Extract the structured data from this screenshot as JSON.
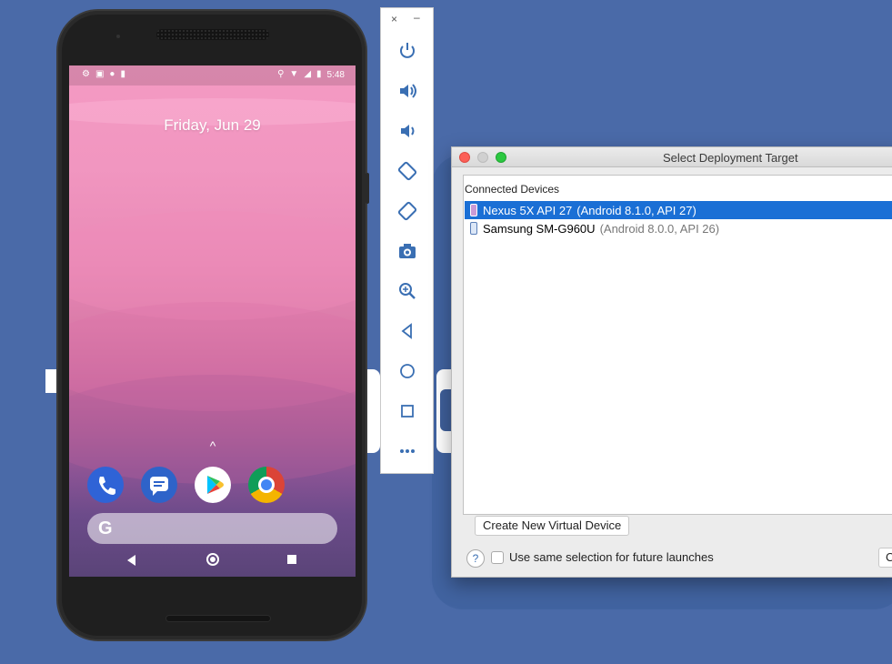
{
  "phone": {
    "status_time": "5:48",
    "date_text": "Friday, Jun 29",
    "dock_apps": [
      "phone-app",
      "messages-app",
      "play-store-app",
      "chrome-app"
    ],
    "search_logo": "G",
    "up_arrow": "^"
  },
  "emulator_toolbar": {
    "close_glyph": "×",
    "minimize_glyph": "–",
    "buttons": [
      {
        "name": "power",
        "glyph": "⏻"
      },
      {
        "name": "volume-up",
        "glyph": "🔊"
      },
      {
        "name": "volume-down",
        "glyph": "🔉"
      },
      {
        "name": "rotate-left",
        "glyph": "⟲"
      },
      {
        "name": "rotate-right",
        "glyph": "⟳"
      },
      {
        "name": "screenshot",
        "glyph": "📷"
      },
      {
        "name": "zoom",
        "glyph": "🔍"
      },
      {
        "name": "back",
        "glyph": "◁"
      },
      {
        "name": "home",
        "glyph": "○"
      },
      {
        "name": "overview",
        "glyph": "□"
      },
      {
        "name": "more",
        "glyph": "•••"
      }
    ]
  },
  "dialog": {
    "title": "Select Deployment Target",
    "list_header": "Connected Devices",
    "devices": [
      {
        "name": "Nexus 5X API 27",
        "detail": "(Android 8.1.0, API 27)",
        "selected": true
      },
      {
        "name": "Samsung SM-G960U",
        "detail": "(Android 8.0.0, API 26)",
        "selected": false
      }
    ],
    "create_button": "Create New Virtual Device",
    "help_label": "?",
    "checkbox_label": "Use same selection for future launches",
    "checkbox_checked": false,
    "cut_button_label": "C"
  },
  "colors": {
    "background": "#4a6aa8",
    "selection": "#1a6fd5",
    "toolbar_icon": "#3a6fb3"
  }
}
